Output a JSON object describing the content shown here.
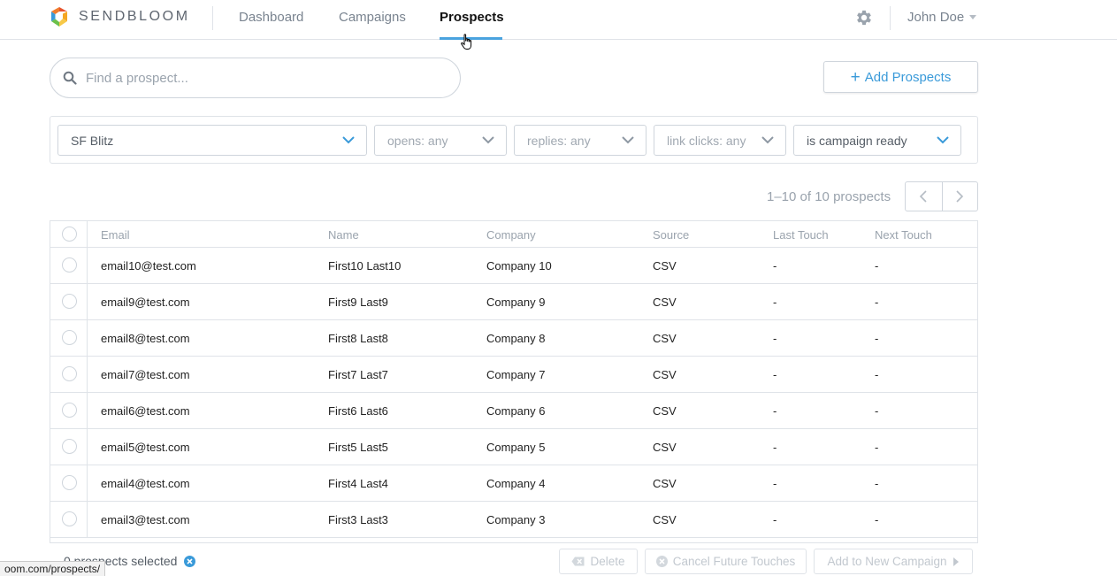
{
  "brand": {
    "name": "SENDBLOOM"
  },
  "nav": {
    "items": [
      {
        "label": "Dashboard"
      },
      {
        "label": "Campaigns"
      },
      {
        "label": "Prospects"
      }
    ],
    "active": "Prospects"
  },
  "user": {
    "name": "John Doe"
  },
  "icons": {
    "settings": "gear-icon",
    "search": "search-icon",
    "dropdown": "chevron-down-icon",
    "cursor": "hand-pointer-icon"
  },
  "colors": {
    "accent": "#4aa3df",
    "link": "#3a9ad9"
  },
  "search": {
    "placeholder": "Find a prospect..."
  },
  "actions": {
    "add_prospects": "Add Prospects"
  },
  "filters": {
    "campaign": "SF Blitz",
    "opens": "opens: any",
    "replies": "replies: any",
    "link_clicks": "link clicks: any",
    "campaign_ready": "is campaign ready"
  },
  "pagination": {
    "summary": "1–10 of 10 prospects"
  },
  "table": {
    "columns": [
      "Email",
      "Name",
      "Company",
      "Source",
      "Last Touch",
      "Next Touch"
    ],
    "rows": [
      {
        "email": "email10@test.com",
        "name": "First10 Last10",
        "company": "Company 10",
        "source": "CSV",
        "last_touch": "-",
        "next_touch": "-"
      },
      {
        "email": "email9@test.com",
        "name": "First9 Last9",
        "company": "Company 9",
        "source": "CSV",
        "last_touch": "-",
        "next_touch": "-"
      },
      {
        "email": "email8@test.com",
        "name": "First8 Last8",
        "company": "Company 8",
        "source": "CSV",
        "last_touch": "-",
        "next_touch": "-"
      },
      {
        "email": "email7@test.com",
        "name": "First7 Last7",
        "company": "Company 7",
        "source": "CSV",
        "last_touch": "-",
        "next_touch": "-"
      },
      {
        "email": "email6@test.com",
        "name": "First6 Last6",
        "company": "Company 6",
        "source": "CSV",
        "last_touch": "-",
        "next_touch": "-"
      },
      {
        "email": "email5@test.com",
        "name": "First5 Last5",
        "company": "Company 5",
        "source": "CSV",
        "last_touch": "-",
        "next_touch": "-"
      },
      {
        "email": "email4@test.com",
        "name": "First4 Last4",
        "company": "Company 4",
        "source": "CSV",
        "last_touch": "-",
        "next_touch": "-"
      },
      {
        "email": "email3@test.com",
        "name": "First3 Last3",
        "company": "Company 3",
        "source": "CSV",
        "last_touch": "-",
        "next_touch": "-"
      }
    ]
  },
  "footer": {
    "selected": "0 prospects selected",
    "delete": "Delete",
    "cancel_touches": "Cancel Future Touches",
    "add_to_campaign": "Add to New Campaign"
  },
  "status_bar": {
    "url": "oom.com/prospects/"
  }
}
